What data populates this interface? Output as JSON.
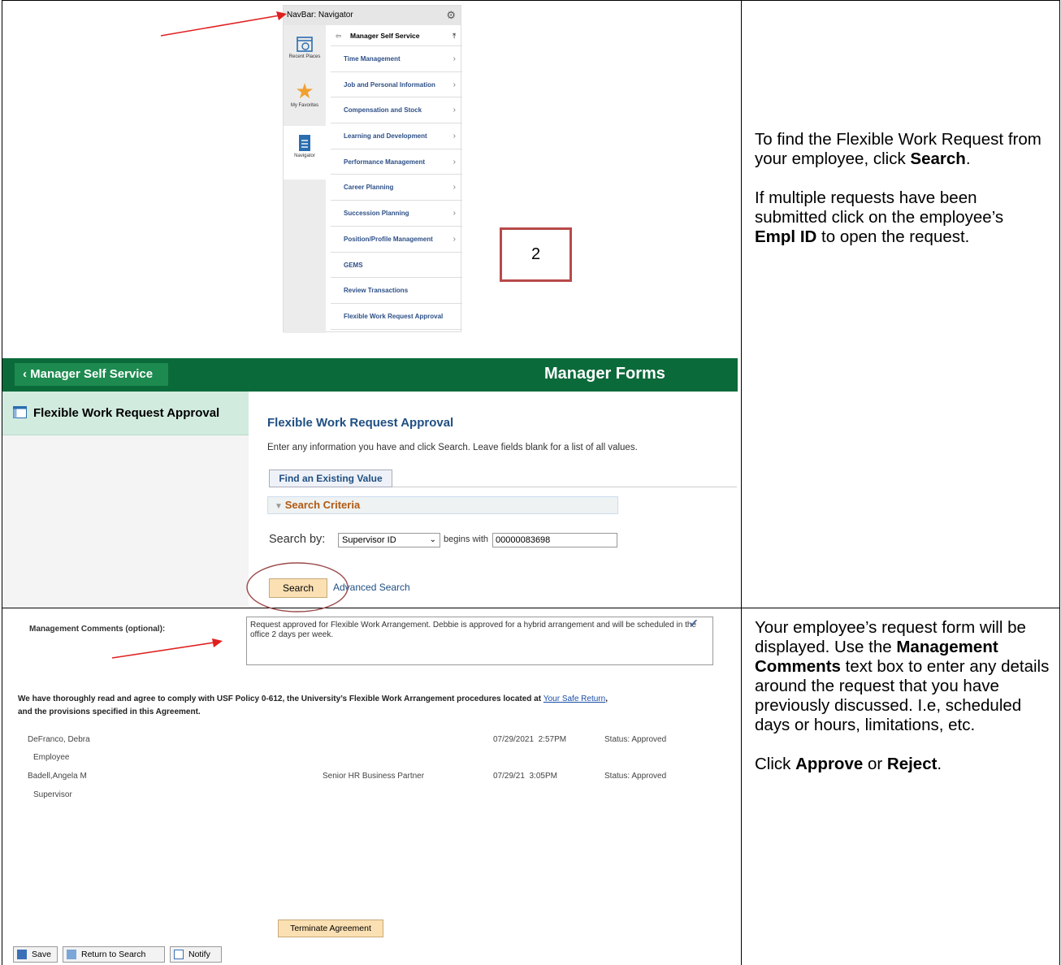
{
  "navigator": {
    "header": "NavBar: Navigator",
    "side_tiles": [
      "Recent Places",
      "My Favorites",
      "Navigator"
    ],
    "section_title": "Manager Self Service",
    "items": [
      "Time Management",
      "Job and Personal Information",
      "Compensation and Stock",
      "Learning and Development",
      "Performance Management",
      "Career Planning",
      "Succession Planning",
      "Position/Profile Management",
      "GEMS",
      "Review Transactions",
      "Flexible Work Request Approval"
    ]
  },
  "step_number": "2",
  "manager_forms": {
    "back_label": "Manager Self Service",
    "title": "Manager Forms",
    "left_item": "Flexible Work Request Approval",
    "page_title": "Flexible Work Request Approval",
    "description": "Enter any information you have and click Search. Leave fields blank for a list of all values.",
    "tab_label": "Find an Existing Value",
    "criteria_label": "Search Criteria",
    "search_by_label": "Search by:",
    "search_by_value": "Supervisor ID",
    "begins_with": "begins with",
    "search_value": "00000083698",
    "search_button": "Search",
    "advanced_search": "Advanced Search"
  },
  "instructions1": {
    "p1_a": "To find the Flexible Work Request from your employee, click ",
    "p1_b": "Search",
    "p1_c": ".",
    "p2_a": "If multiple requests have been submitted click on the employee’s ",
    "p2_b": "Empl ID",
    "p2_c": " to open the request."
  },
  "request_form": {
    "comments_label": "Management Comments (optional):",
    "comments_value": "Request approved for Flexible Work Arrangement.  Debbie is approved for a hybrid arrangement and will be scheduled in the office 2 days per week.",
    "agreement_text": "We have thoroughly read and agree to comply with USF Policy 0-612, the University’s Flexible Work Arrangement procedures located at ",
    "agreement_link": "Your Safe Return",
    "agreement_end": ",",
    "agreement_line2": "and the provisions specified in this Agreement.",
    "signers": [
      {
        "name": "DeFranco, Debra",
        "role": "Employee",
        "title": "",
        "date": "07/29/2021  2:57PM",
        "status": "Status: Approved"
      },
      {
        "name": "Badell,Angela M",
        "role": "Supervisor",
        "title": "Senior HR Business Partner",
        "date": "07/29/21  3:05PM",
        "status": "Status: Approved"
      }
    ],
    "terminate_button": "Terminate Agreement",
    "toolbar": {
      "save": "Save",
      "return": "Return to Search",
      "notify": "Notify"
    }
  },
  "instructions2": {
    "p1_a": "Your employee’s request form will be displayed.  Use the ",
    "p1_b": "Management Comments",
    "p1_c": " text box to enter any details around the request that you have previously discussed.  I.e, scheduled days or hours, limitations, etc.",
    "p2_a": "Click ",
    "p2_b": "Approve",
    "p2_c": " or ",
    "p2_d": "Reject",
    "p2_e": "."
  },
  "colors": {
    "green_header": "#0b6a3a",
    "annotation_red": "#c0392b",
    "link_blue": "#1f4f82"
  }
}
